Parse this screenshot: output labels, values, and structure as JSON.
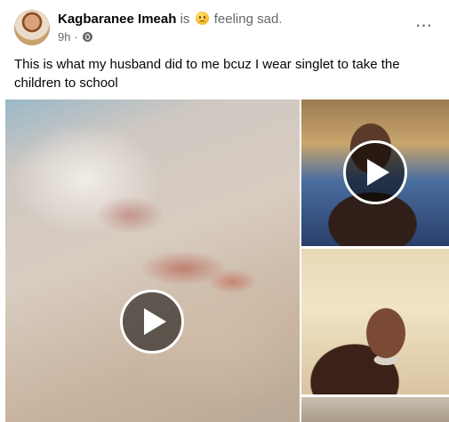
{
  "post": {
    "author": "Kagbaranee Imeah",
    "is_text": "is",
    "feeling_text": "feeling sad.",
    "feeling_emoji": "sad-face-icon",
    "timestamp": "9h",
    "separator": "·",
    "audience_icon": "globe-icon",
    "more_label": "···",
    "caption": "This is what my husband did to me bcuz I wear singlet to take the children to school"
  },
  "media": {
    "tiles": [
      {
        "kind": "video",
        "icon": "play-icon"
      },
      {
        "kind": "video",
        "icon": "play-icon"
      },
      {
        "kind": "image"
      },
      {
        "kind": "image"
      }
    ]
  }
}
